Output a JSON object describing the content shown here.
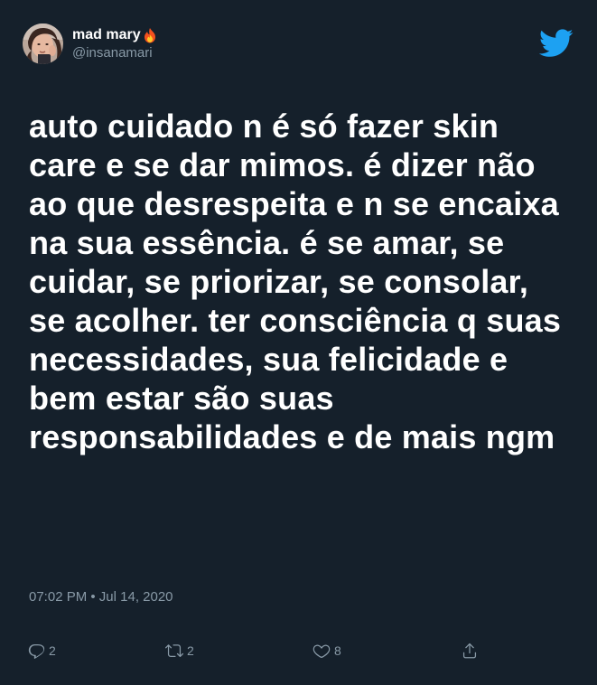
{
  "user": {
    "display_name": "mad mary",
    "name_emoji": "fire-icon",
    "handle": "@insanamari",
    "avatar": "avatar"
  },
  "brand": {
    "icon": "twitter-bird-icon",
    "color": "#1da1f2"
  },
  "tweet": {
    "text": "auto cuidado n é só fazer skin care e se dar mimos. é dizer não ao que desrespeita e n se encaixa na sua essência. é se amar, se cuidar, se priorizar, se consolar, se acolher. ter consciência q suas necessidades, sua felicidade e bem estar são suas responsabilidades e de mais ngm",
    "timestamp": "07:02 PM • Jul 14, 2020"
  },
  "actions": {
    "reply": {
      "icon": "reply-icon",
      "count": "2"
    },
    "retweet": {
      "icon": "retweet-icon",
      "count": "2"
    },
    "like": {
      "icon": "heart-icon",
      "count": "8"
    },
    "share": {
      "icon": "share-icon"
    }
  },
  "colors": {
    "background": "#15202b",
    "text": "#ffffff",
    "secondary": "#8899a6"
  }
}
